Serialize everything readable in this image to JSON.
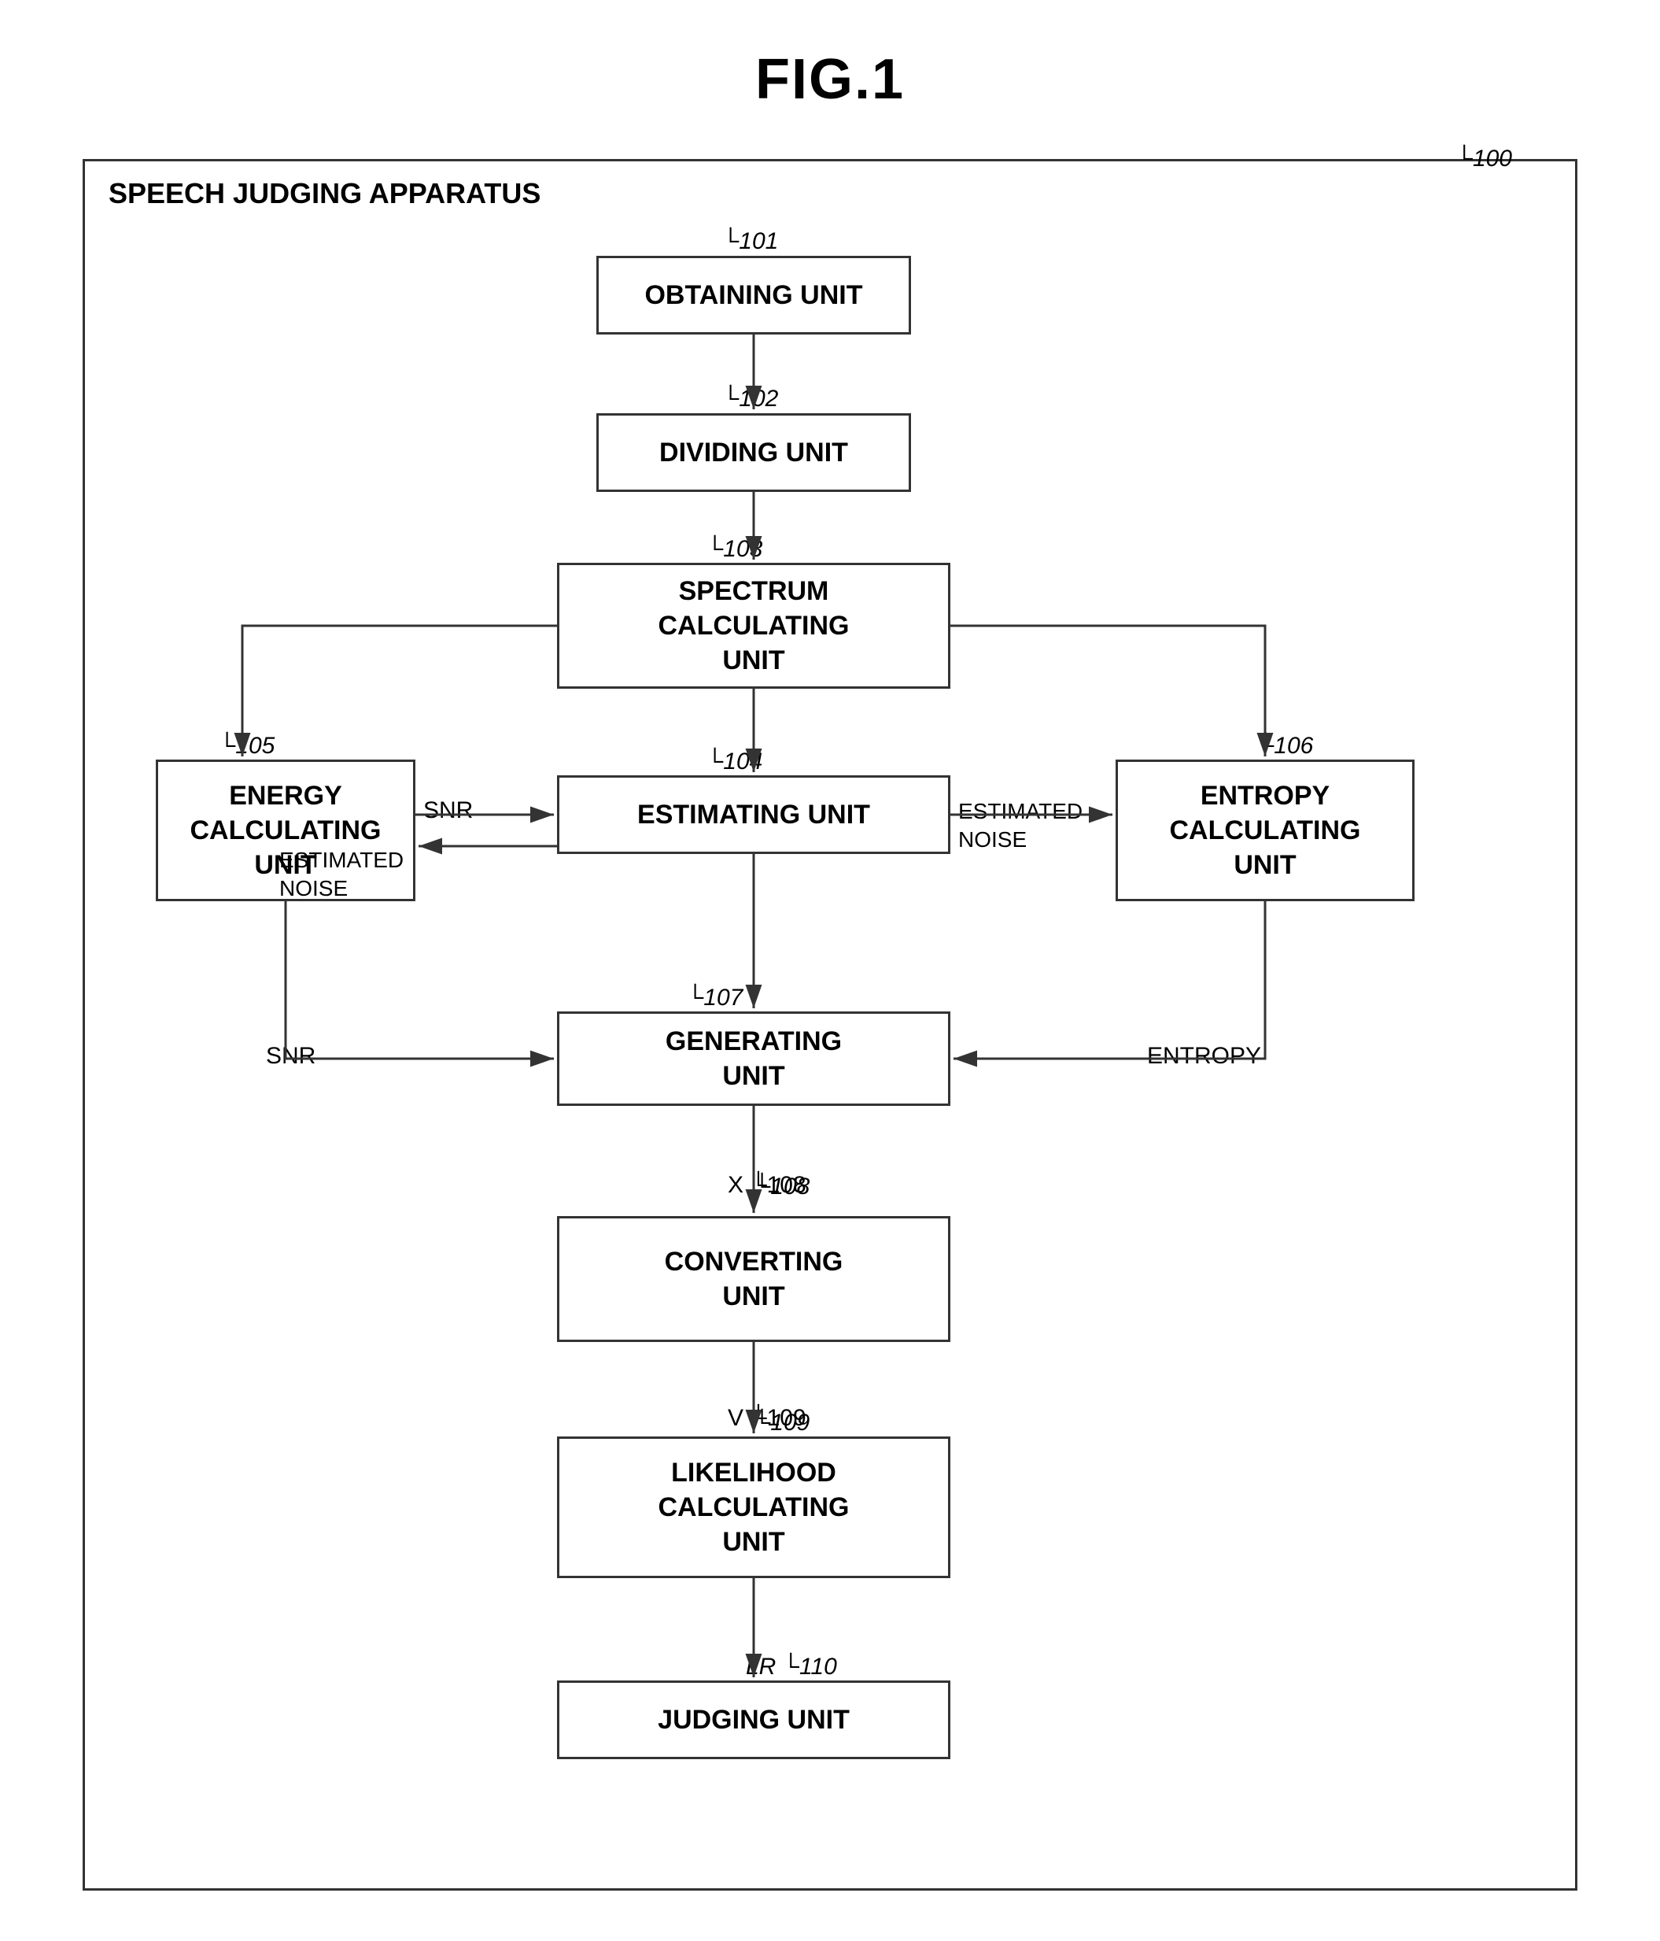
{
  "title": "FIG.1",
  "diagram": {
    "ref_outer": "100",
    "apparatus_label": "SPEECH JUDGING APPARATUS",
    "blocks": [
      {
        "id": "obtaining",
        "label": "OBTAINING UNIT",
        "ref": "101"
      },
      {
        "id": "dividing",
        "label": "DIVIDING UNIT",
        "ref": "102"
      },
      {
        "id": "spectrum",
        "label": "SPECTRUM\nCALCULATING\nUNIT",
        "ref": "103"
      },
      {
        "id": "estimating",
        "label": "ESTIMATING UNIT",
        "ref": "104"
      },
      {
        "id": "energy",
        "label": "ENERGY\nCALCULATING\nUNIT",
        "ref": "105"
      },
      {
        "id": "entropy",
        "label": "ENTROPY\nCALCULATING\nUNIT",
        "ref": "106"
      },
      {
        "id": "generating",
        "label": "GENERATING\nUNIT",
        "ref": "107"
      },
      {
        "id": "converting",
        "label": "CONVERTING\nUNIT",
        "ref": "108"
      },
      {
        "id": "likelihood",
        "label": "LIKELIHOOD\nCALCULATING\nUNIT",
        "ref": "109"
      },
      {
        "id": "judging",
        "label": "JUDGING UNIT",
        "ref": "110"
      }
    ],
    "arrow_labels": [
      {
        "id": "snr1",
        "text": "SNR"
      },
      {
        "id": "estimated_noise1",
        "text": "ESTIMATED\nNOISE"
      },
      {
        "id": "estimated_noise2",
        "text": "ESTIMATED\nNOISE"
      },
      {
        "id": "snr2",
        "text": "SNR"
      },
      {
        "id": "entropy",
        "text": "ENTROPY"
      },
      {
        "id": "x_label",
        "text": "X"
      },
      {
        "id": "v_label",
        "text": "V"
      },
      {
        "id": "lr_label",
        "text": "LR"
      }
    ]
  }
}
